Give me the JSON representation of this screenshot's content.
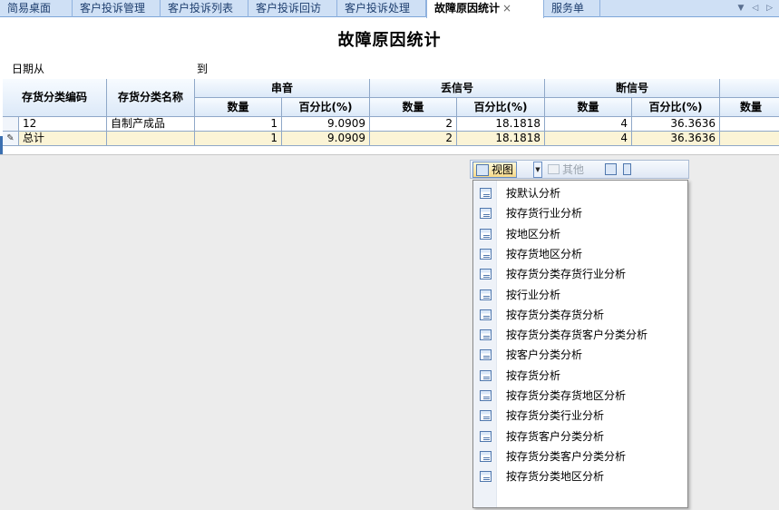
{
  "tabs": [
    {
      "label": "简易桌面"
    },
    {
      "label": "客户投诉管理"
    },
    {
      "label": "客户投诉列表"
    },
    {
      "label": "客户投诉回访"
    },
    {
      "label": "客户投诉处理"
    },
    {
      "label": "故障原因统计",
      "close": "×"
    },
    {
      "label": "服务单"
    }
  ],
  "tab_nav": "▼ ◁ ▷",
  "report": {
    "title": "故障原因统计",
    "date_from_label": "日期从",
    "date_to_label": "到"
  },
  "grid": {
    "headers": {
      "code": "存货分类编码",
      "name": "存货分类名称",
      "groups": [
        "串音",
        "丢信号",
        "断信号"
      ],
      "qty": "数量",
      "pct": "百分比(%)"
    },
    "rows": [
      {
        "code": "12",
        "name": "自制产成品",
        "values": [
          "1",
          "9.0909",
          "2",
          "18.1818",
          "4",
          "36.3636"
        ]
      }
    ],
    "total": {
      "label": "总计",
      "values": [
        "1",
        "9.0909",
        "2",
        "18.1818",
        "4",
        "36.3636"
      ]
    }
  },
  "toolbar": {
    "view_label": "视图",
    "other_label": "其他"
  },
  "view_menu": [
    "按默认分析",
    "按存货行业分析",
    "按地区分析",
    "按存货地区分析",
    "按存货分类存货行业分析",
    "按行业分析",
    "按存货分类存货分析",
    "按存货分类存货客户分类分析",
    "按客户分类分析",
    "按存货分析",
    "按存货分类存货地区分析",
    "按存货分类行业分析",
    "按存货客户分类分析",
    "按存货分类客户分类分析",
    "按存货分类地区分析"
  ]
}
